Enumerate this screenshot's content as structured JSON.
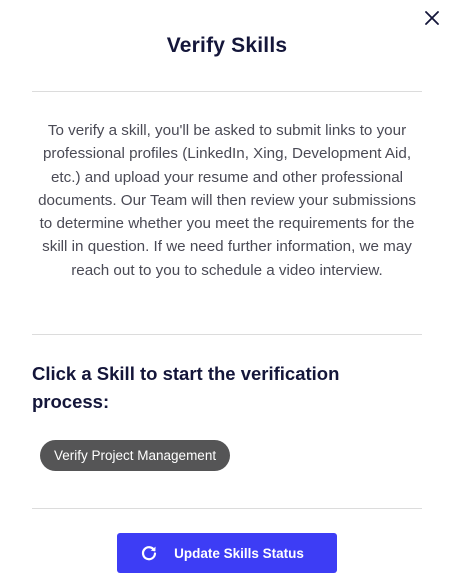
{
  "modal": {
    "title": "Verify Skills",
    "description": "To verify a skill, you'll be asked to submit links to your professional profiles (LinkedIn, Xing, Development Aid, etc.) and upload your resume and other professional documents. Our Team will then review your submissions to determine whether you meet the requirements for the skill in question. If we need further information, we may reach out to you to schedule a video interview.",
    "section_heading": "Click a Skill to start the verification process:",
    "skills": [
      {
        "label": "Verify Project Management"
      }
    ],
    "update_button": {
      "label": "Update Skills Status",
      "icon": "refresh-icon"
    },
    "close_icon": "close-icon"
  },
  "colors": {
    "title": "#14163a",
    "text": "#4a4a55",
    "chip_bg": "#555556",
    "button_bg": "#3d3df5",
    "divider": "#dcdcdc"
  }
}
